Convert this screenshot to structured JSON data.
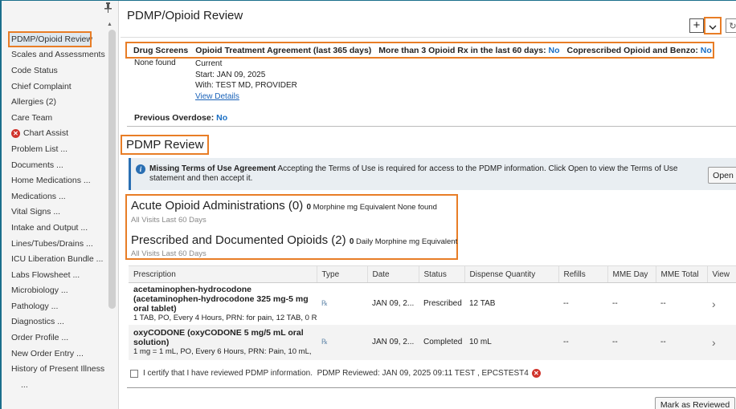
{
  "sidebar": {
    "pin_glyph": "📌",
    "items": [
      {
        "label": "PDMP/Opioid Review"
      },
      {
        "label": "Scales and Assessments"
      },
      {
        "label": "Code Status"
      },
      {
        "label": "Chief Complaint"
      },
      {
        "label": "Allergies (2)"
      },
      {
        "label": "Care Team"
      },
      {
        "label": "Chart Assist"
      },
      {
        "label": "Problem List ..."
      },
      {
        "label": "Documents ..."
      },
      {
        "label": "Home Medications ..."
      },
      {
        "label": "Medications ..."
      },
      {
        "label": "Vital Signs ..."
      },
      {
        "label": "Intake and Output ..."
      },
      {
        "label": "Lines/Tubes/Drains ..."
      },
      {
        "label": "ICU Liberation Bundle ..."
      },
      {
        "label": "Labs Flowsheet ..."
      },
      {
        "label": "Microbiology ..."
      },
      {
        "label": "Pathology ..."
      },
      {
        "label": "Diagnostics ..."
      },
      {
        "label": "Order Profile ..."
      },
      {
        "label": "New Order Entry ..."
      },
      {
        "label": "History of Present Illness"
      },
      {
        "label": "..."
      }
    ]
  },
  "header": {
    "title": "PDMP/Opioid Review",
    "plus": "+"
  },
  "screens": {
    "drug_screens": "Drug Screens",
    "agreement": "Opioid Treatment Agreement (last 365 days)",
    "more_than_3_label": "More than 3 Opioid Rx in the last 60 days:",
    "more_than_3_value": "No",
    "coprescribed_label": "Coprescribed Opioid and Benzo:",
    "coprescribed_value": "No"
  },
  "drug_screen_result": "None found",
  "agreement_detail": {
    "status": "Current",
    "start": "Start: JAN 09, 2025",
    "with": "With: TEST MD, PROVIDER",
    "link": "View Details"
  },
  "previous_overdose": {
    "label": "Previous Overdose:",
    "value": "No"
  },
  "pdmp": {
    "title": "PDMP Review",
    "banner_bold": "Missing Terms of Use Agreement",
    "banner_text": "Accepting the Terms of Use is required for access to the PDMP information. Click Open to view the Terms of Use statement and then accept it.",
    "open_button": "Open"
  },
  "acute": {
    "title": "Acute Opioid Administrations (0)",
    "value": "0",
    "unit": "Morphine mg Equivalent",
    "none": "None found",
    "sub": "All Visits Last 60 Days"
  },
  "prescribed": {
    "title": "Prescribed and Documented Opioids (2)",
    "value": "0",
    "unit": "Daily Morphine mg Equivalent",
    "sub": "All Visits Last 60 Days"
  },
  "table": {
    "columns": [
      "Prescription",
      "Type",
      "Date",
      "Status",
      "Dispense Quantity",
      "Refills",
      "MME Day",
      "MME Total",
      "View"
    ],
    "rows": [
      {
        "name": "acetaminophen-hydrocodone (acetaminophen-hydrocodone 325 mg-5 mg oral tablet)",
        "detail": "1 TAB, PO, Every 4 Hours, PRN: for pain, 12 TAB, 0 R",
        "type_icon": "prescription-icon",
        "date": "JAN 09, 2...",
        "status": "Prescribed",
        "dispense": "12 TAB",
        "refills": "--",
        "mme_day": "--",
        "mme_total": "--"
      },
      {
        "name": "oxyCODONE (oxyCODONE 5 mg/5 mL oral solution)",
        "detail": "1 mg = 1 mL, PO, Every 6 Hours, PRN: Pain, 10 mL,",
        "type_icon": "prescription-icon",
        "date": "JAN 09, 2...",
        "status": "Completed",
        "dispense": "10 mL",
        "refills": "--",
        "mme_day": "--",
        "mme_total": "--"
      }
    ]
  },
  "certify": {
    "label": "I certify that I have reviewed PDMP information.",
    "reviewed": "PDMP Reviewed: JAN 09, 2025 09:11 TEST , EPCSTEST4"
  },
  "mark_button": "Mark as Reviewed",
  "colors": {
    "accent_highlight": "#e87d26",
    "link_blue": "#1a62b8",
    "alert_red": "#d0342c"
  }
}
